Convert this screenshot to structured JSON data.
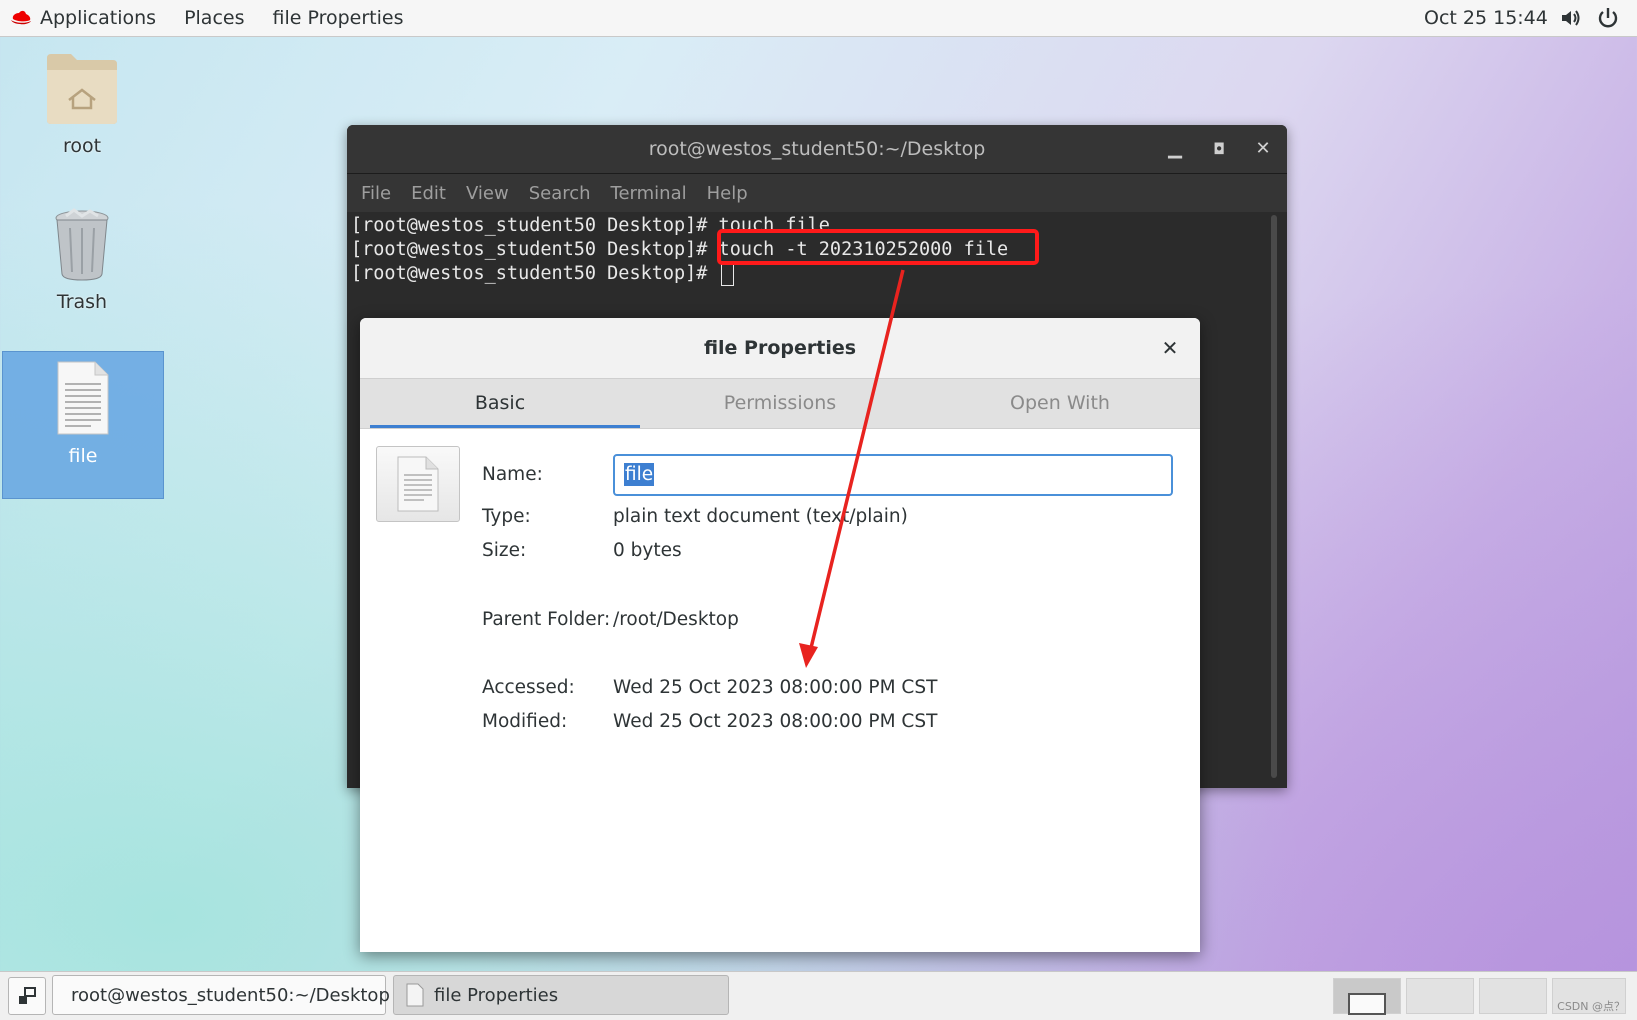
{
  "topbar": {
    "applications": "Applications",
    "places": "Places",
    "active_app": "file Properties",
    "clock": "Oct 25  15:44"
  },
  "desktop": {
    "icons": [
      {
        "label": "root"
      },
      {
        "label": "Trash"
      },
      {
        "label": "file"
      }
    ]
  },
  "terminal": {
    "title": "root@westos_student50:~/Desktop",
    "menu": [
      "File",
      "Edit",
      "View",
      "Search",
      "Terminal",
      "Help"
    ],
    "lines": [
      "[root@westos_student50 Desktop]# touch file",
      "[root@westos_student50 Desktop]# touch -t 202310252000 file",
      "[root@westos_student50 Desktop]# "
    ]
  },
  "dialog": {
    "title": "file Properties",
    "tabs": [
      "Basic",
      "Permissions",
      "Open With"
    ],
    "name_label": "Name:",
    "name_value": "file",
    "type_label": "Type:",
    "type_value": "plain text document (text/plain)",
    "size_label": "Size:",
    "size_value": "0 bytes",
    "parent_label": "Parent Folder:",
    "parent_value": "/root/Desktop",
    "accessed_label": "Accessed:",
    "accessed_value": "Wed 25 Oct 2023 08:00:00 PM CST",
    "modified_label": "Modified:",
    "modified_value": "Wed 25 Oct 2023 08:00:00 PM CST"
  },
  "taskbar": {
    "items": [
      {
        "label": "root@westos_student50:~/Desktop"
      },
      {
        "label": "file Properties"
      }
    ],
    "watermark": "CSDN @点？"
  },
  "colors": {
    "highlight_box": "#ff1a1a",
    "arrow": "#e8231f",
    "selection": "#3d7fd1"
  }
}
